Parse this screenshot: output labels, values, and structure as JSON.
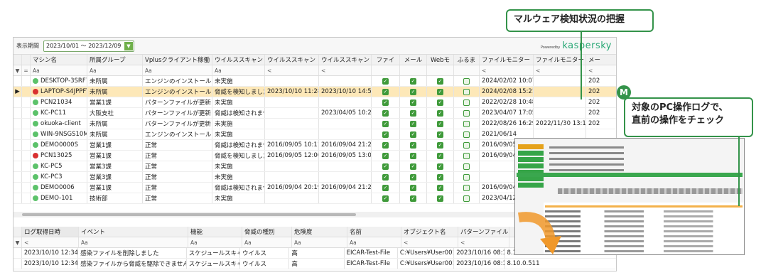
{
  "toolbar": {
    "period_label": "表示期間",
    "period_value": "2023/10/01 ～ 2023/12/09",
    "powered_by": "Poweredby",
    "brand": "kaspersky"
  },
  "device_grid": {
    "headers": [
      "マシン名",
      "所属グループ",
      "Vplusクライアント稼働",
      "ウイルススキャン",
      "ウイルススキャン",
      "ウイルススキャン",
      "ファイ",
      "メール",
      "Webモ",
      "ふるま",
      "ファイルモニター",
      "ファイルモニター",
      "メー"
    ],
    "filters": [
      "Aa",
      "Aa",
      "Aa",
      "Aa",
      "<",
      "<",
      "",
      "",
      "",
      "",
      "<",
      "<",
      "<"
    ],
    "rows": [
      {
        "name": "DESKTOP-3SRF73",
        "status": "green",
        "group": "未所属",
        "client": "エンジンのインストールに",
        "scan1": "未実施",
        "scan2": "",
        "scan3": "",
        "f": true,
        "m": true,
        "w": true,
        "b": false,
        "mon1": "2024/02/02 10:07",
        "mon2": "",
        "last": "202"
      },
      {
        "name": "LAPTOP-S4JPPFTO",
        "status": "red",
        "group": "未所属",
        "client": "エンジンのインストールに",
        "scan1": "脅威を検知しました",
        "scan2": "2023/10/10 11:28",
        "scan3": "2023/10/10 14:58",
        "f": true,
        "m": true,
        "w": true,
        "b": false,
        "mon1": "2024/02/08 15:21",
        "mon2": "",
        "last": "202"
      },
      {
        "name": "PCN21034",
        "status": "green",
        "group": "営業1課",
        "client": "パターンファイルが更新さ",
        "scan1": "未実施",
        "scan2": "",
        "scan3": "",
        "f": true,
        "m": true,
        "w": true,
        "b": false,
        "mon1": "2022/02/28 10:48",
        "mon2": "",
        "last": "202"
      },
      {
        "name": "KC-PC11",
        "status": "green",
        "group": "大阪支社",
        "client": "パターンファイルが更新さ",
        "scan1": "脅威は検知されませ",
        "scan2": "",
        "scan3": "2023/04/05 10:28",
        "f": true,
        "m": true,
        "w": true,
        "b": false,
        "mon1": "2023/04/07 17:05",
        "mon2": "",
        "last": "202"
      },
      {
        "name": "okuoka-client",
        "status": "green",
        "group": "未所属",
        "client": "パターンファイルが更新さ",
        "scan1": "未実施",
        "scan2": "",
        "scan3": "",
        "f": true,
        "m": true,
        "w": true,
        "b": false,
        "mon1": "2022/08/26 16:29",
        "mon2": "2022/11/30 13:16",
        "last": "202"
      },
      {
        "name": "WIN-9NSGS10M63",
        "status": "green",
        "group": "未所属",
        "client": "エンジンのインストールに",
        "scan1": "未実施",
        "scan2": "",
        "scan3": "",
        "f": true,
        "m": true,
        "w": true,
        "b": false,
        "mon1": "2021/06/14",
        "mon2": "",
        "last": ""
      },
      {
        "name": "DEMO0000S",
        "status": "green",
        "group": "営業1課",
        "client": "正常",
        "scan1": "脅威は検知されませ",
        "scan2": "2016/09/05 10:11",
        "scan3": "2016/09/04 21:20",
        "f": true,
        "m": true,
        "w": true,
        "b": false,
        "mon1": "2016/09/05",
        "mon2": "",
        "last": ""
      },
      {
        "name": "PCN13025",
        "status": "red",
        "group": "営業1課",
        "client": "正常",
        "scan1": "脅威を検知しました",
        "scan2": "2016/09/05 12:00",
        "scan3": "2016/09/05 13:03",
        "f": true,
        "m": true,
        "w": true,
        "b": false,
        "mon1": "2016/09/04",
        "mon2": "",
        "last": ""
      },
      {
        "name": "KC-PC5",
        "status": "green",
        "group": "営業3課",
        "client": "正常",
        "scan1": "未実施",
        "scan2": "",
        "scan3": "",
        "f": true,
        "m": true,
        "w": true,
        "b": false,
        "mon1": "",
        "mon2": "",
        "last": ""
      },
      {
        "name": "KC-PC3",
        "status": "green",
        "group": "営業3課",
        "client": "正常",
        "scan1": "未実施",
        "scan2": "",
        "scan3": "",
        "f": true,
        "m": true,
        "w": true,
        "b": false,
        "mon1": "",
        "mon2": "",
        "last": ""
      },
      {
        "name": "DEMO0006",
        "status": "green",
        "group": "営業1課",
        "client": "正常",
        "scan1": "脅威は検知されませ",
        "scan2": "2016/09/04 20:19",
        "scan3": "2016/09/04 21:20",
        "f": true,
        "m": true,
        "w": true,
        "b": false,
        "mon1": "2016/09/04",
        "mon2": "",
        "last": ""
      },
      {
        "name": "DEMO-101",
        "status": "green",
        "group": "技術部",
        "client": "正常",
        "scan1": "未実施",
        "scan2": "",
        "scan3": "",
        "f": true,
        "m": true,
        "w": true,
        "b": false,
        "mon1": "2023/04/12",
        "mon2": "",
        "last": ""
      }
    ]
  },
  "log_grid": {
    "tab": "ログ取得日時",
    "headers": [
      "イベント",
      "機能",
      "脅威の種別",
      "危険度",
      "名前",
      "オブジェクト名",
      "パターンファイル"
    ],
    "filters": [
      "<",
      "Aa",
      "Aa",
      "Aa",
      "Aa",
      "Aa",
      "<",
      "<"
    ],
    "rows": [
      {
        "time": "2023/10/10 12:34",
        "event": "感染ファイルを削除しました",
        "func": "スケジュールスキャ",
        "type": "ウイルス",
        "risk": "高",
        "name": "EICAR-Test-File",
        "object": "C:¥Users¥User001",
        "pattern": "2023/10/16 08:12",
        "ver": "8.10.0.511"
      },
      {
        "time": "2023/10/10 12:34",
        "event": "感染ファイルから脅威を駆除できませんでし",
        "func": "スケジュールスキャ",
        "type": "ウイルス",
        "risk": "高",
        "name": "EICAR-Test-File",
        "object": "C:¥Users¥User001",
        "pattern": "2023/10/16 08:12",
        "ver": "8.10.0.511"
      }
    ]
  },
  "callouts": {
    "malware": "マルウェア検知状況の把握",
    "oplog_line1": "対象のPC操作ログで、",
    "oplog_line2": "直前の操作をチェック",
    "badge": "M"
  },
  "colors": {
    "accent_green": "#34934a",
    "selected_row": "#fde8b8",
    "status_red": "#d93030",
    "status_green": "#5cc26a",
    "arrow": "#f0982a"
  }
}
